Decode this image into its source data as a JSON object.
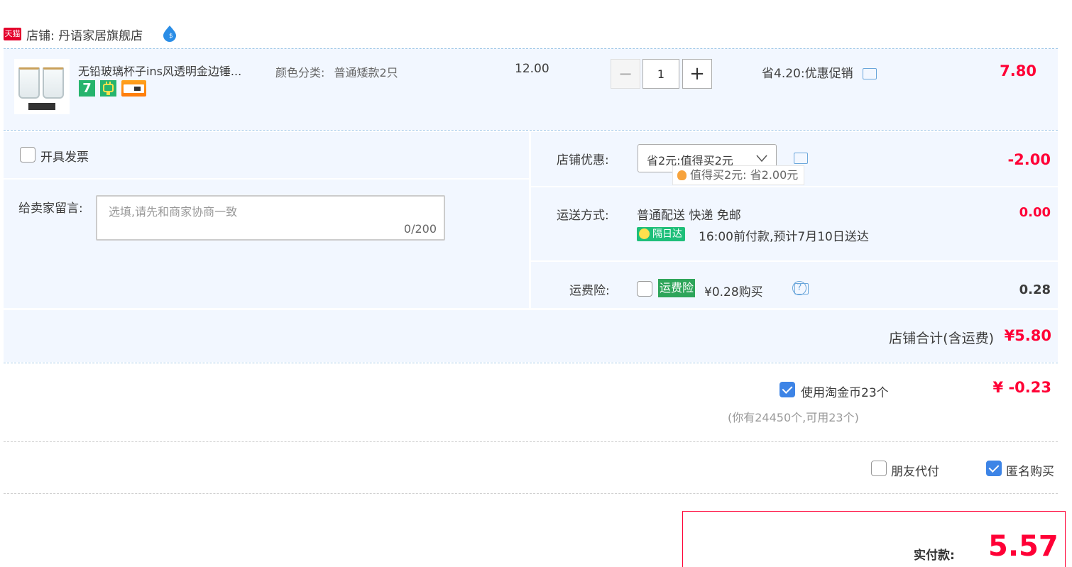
{
  "shop": {
    "badge": "天猫",
    "label": "店铺:",
    "name": "丹语家居旗舰店"
  },
  "item": {
    "title": "无铅玻璃杯子ins风透明金边锤...",
    "sku_label": "颜色分类:",
    "sku_value": "普通矮款2只",
    "unit_price": "12.00",
    "quantity": "1",
    "minus": "−",
    "plus": "+",
    "promo": "省4.20:优惠促销",
    "total": "7.80",
    "badge7": "7"
  },
  "invoice": {
    "label": "开具发票"
  },
  "message": {
    "label": "给卖家留言:",
    "placeholder": "选填,请先和商家协商一致",
    "counter": "0/200"
  },
  "coupon": {
    "label": "店铺优惠:",
    "selected": "省2元:值得买2元",
    "tooltip": "值得买2元:  省2.00元",
    "amount": "-2.00"
  },
  "delivery": {
    "label": "运送方式:",
    "method": "普通配送 快递 免邮",
    "badge": "隔日达",
    "note": "16:00前付款,预计7月10日送达",
    "amount": "0.00"
  },
  "insurance": {
    "label": "运费险:",
    "badge": "运费险",
    "price": "¥0.28购买",
    "amount": "0.28"
  },
  "shop_total": {
    "label": "店铺合计(含运费)",
    "amount": "¥5.80"
  },
  "coins": {
    "label": "使用淘金币23个",
    "note": "(你有24450个,可用23个)",
    "amount": "¥ -0.23"
  },
  "options": {
    "friend_pay": "朋友代付",
    "anonymous": "匿名购买"
  },
  "payment": {
    "label": "实付款:",
    "amount": "5.57"
  },
  "colors": {
    "accent_red": "#ff0036",
    "panel_bg": "#f2f7ff",
    "check_blue": "#3d84e6",
    "green": "#1ebf7a"
  }
}
